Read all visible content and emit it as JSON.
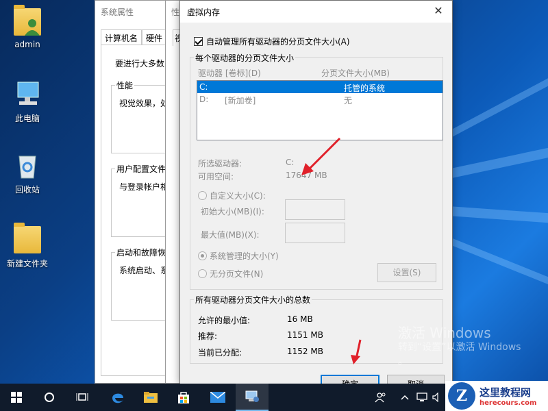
{
  "desktop": {
    "icons": [
      {
        "label": "admin",
        "icon": "user-folder-icon"
      },
      {
        "label": "此电脑",
        "icon": "computer-icon"
      },
      {
        "label": "回收站",
        "icon": "recycle-bin-icon"
      },
      {
        "label": "新建文件夹",
        "icon": "folder-icon"
      }
    ],
    "watermark": {
      "line1": "激活 Windows",
      "line2": "转到“设置”以激活 Windows",
      "line3": "。"
    }
  },
  "system_properties": {
    "title": "系统属性",
    "title2": "性",
    "tabs": [
      "计算机名",
      "硬件",
      "视"
    ],
    "intro": "要进行大多数",
    "groups": [
      {
        "label": "性能",
        "text": "视觉效果，处"
      },
      {
        "label": "用户配置文件",
        "text": "与登录帐户相"
      },
      {
        "label": "启动和故障恢",
        "text": "系统启动、系"
      }
    ]
  },
  "dialog": {
    "title": "虚拟内存",
    "auto_manage": "自动管理所有驱动器的分页文件大小(A)",
    "per_drive_group": "每个驱动器的分页文件大小",
    "col_drive": "驱动器 [卷标](D)",
    "col_size": "分页文件大小(MB)",
    "drives": [
      {
        "drive": "C:",
        "label": "",
        "size": "托管的系统",
        "selected": true
      },
      {
        "drive": "D:",
        "label": "[新加卷]",
        "size": "无",
        "selected": false
      }
    ],
    "selected_drive_label": "所选驱动器:",
    "selected_drive_value": "C:",
    "free_space_label": "可用空间:",
    "free_space_value": "17647 MB",
    "custom_size": "自定义大小(C):",
    "initial_size": "初始大小(MB)(I):",
    "max_size": "最大值(MB)(X):",
    "system_managed": "系统管理的大小(Y)",
    "no_paging": "无分页文件(N)",
    "set_button": "设置(S)",
    "totals_group": "所有驱动器分页文件大小的总数",
    "min_allowed_label": "允许的最小值:",
    "min_allowed_value": "16 MB",
    "recommended_label": "推荐:",
    "recommended_value": "1151 MB",
    "allocated_label": "当前已分配:",
    "allocated_value": "1152 MB",
    "ok_button": "确定",
    "cancel_button": "取消"
  },
  "brand": {
    "name": "这里教程网",
    "url": "herecours.com"
  },
  "colors": {
    "selection": "#0078d7",
    "annotation_arrow": "#e0202a"
  }
}
